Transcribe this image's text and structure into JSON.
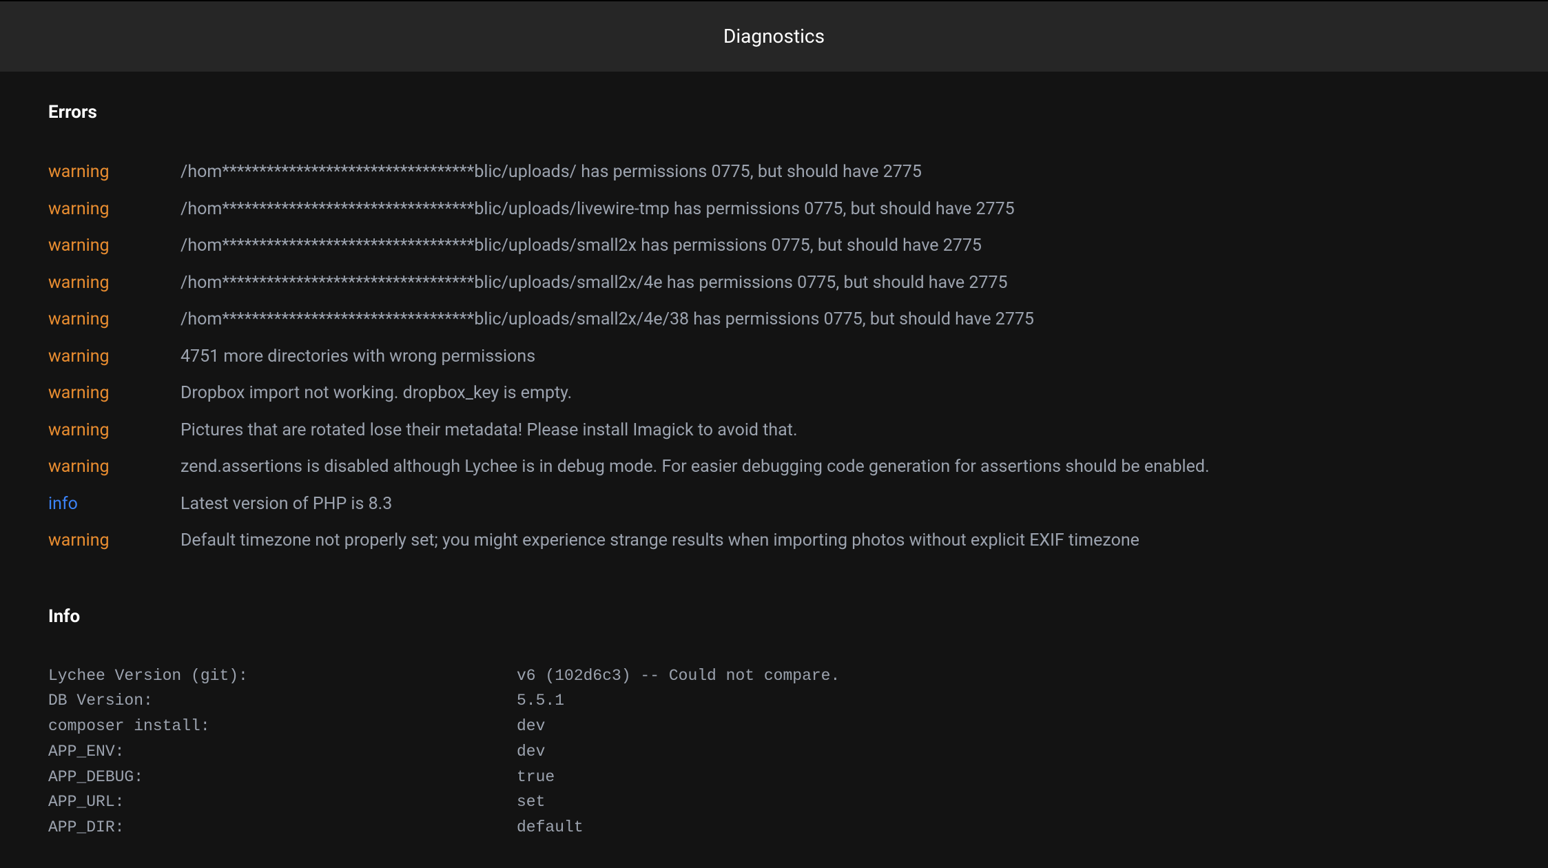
{
  "header": {
    "title": "Diagnostics"
  },
  "errors": {
    "title": "Errors",
    "items": [
      {
        "level": "warning",
        "message": "/hom**********************************blic/uploads/ has permissions 0775, but should have 2775"
      },
      {
        "level": "warning",
        "message": "/hom**********************************blic/uploads/livewire-tmp has permissions 0775, but should have 2775"
      },
      {
        "level": "warning",
        "message": "/hom**********************************blic/uploads/small2x has permissions 0775, but should have 2775"
      },
      {
        "level": "warning",
        "message": "/hom**********************************blic/uploads/small2x/4e has permissions 0775, but should have 2775"
      },
      {
        "level": "warning",
        "message": "/hom**********************************blic/uploads/small2x/4e/38 has permissions 0775, but should have 2775"
      },
      {
        "level": "warning",
        "message": "4751 more directories with wrong permissions"
      },
      {
        "level": "warning",
        "message": "Dropbox import not working. dropbox_key is empty."
      },
      {
        "level": "warning",
        "message": "Pictures that are rotated lose their metadata! Please install Imagick to avoid that."
      },
      {
        "level": "warning",
        "message": "zend.assertions is disabled although Lychee is in debug mode. For easier debugging code generation for assertions should be enabled."
      },
      {
        "level": "info",
        "message": "Latest version of PHP is 8.3"
      },
      {
        "level": "warning",
        "message": "Default timezone not properly set; you might experience strange results when importing photos without explicit EXIF timezone"
      }
    ]
  },
  "info": {
    "title": "Info",
    "items": [
      {
        "key": "Lychee Version (git):",
        "value": "v6 (102d6c3) -- Could not compare."
      },
      {
        "key": "DB Version:",
        "value": "5.5.1"
      },
      {
        "key": "composer install:",
        "value": "dev"
      },
      {
        "key": "APP_ENV:",
        "value": "dev"
      },
      {
        "key": "APP_DEBUG:",
        "value": "true"
      },
      {
        "key": "APP_URL:",
        "value": "set"
      },
      {
        "key": "APP_DIR:",
        "value": "default"
      }
    ]
  }
}
